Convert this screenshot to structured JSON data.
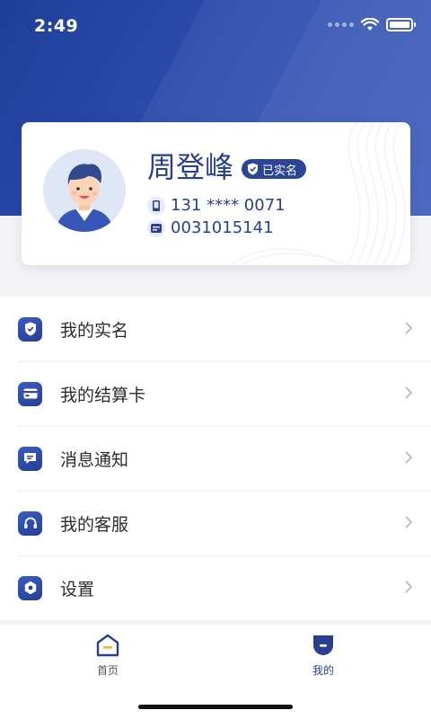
{
  "status_bar": {
    "time": "2:49"
  },
  "profile": {
    "name": "周登峰",
    "badge": "已实名",
    "phone": "131 **** 0071",
    "account": "0031015141"
  },
  "menu": [
    {
      "label": "我的实名",
      "icon": "shield-check-icon"
    },
    {
      "label": "我的结算卡",
      "icon": "card-icon"
    },
    {
      "label": "消息通知",
      "icon": "message-icon"
    },
    {
      "label": "我的客服",
      "icon": "headset-icon"
    },
    {
      "label": "设置",
      "icon": "gear-icon"
    }
  ],
  "tabs": [
    {
      "label": "首页",
      "icon": "home-icon",
      "active": false
    },
    {
      "label": "我的",
      "icon": "profile-icon",
      "active": true
    }
  ],
  "colors": {
    "primary": "#2a3f8f",
    "header": "#2f4fb0"
  }
}
